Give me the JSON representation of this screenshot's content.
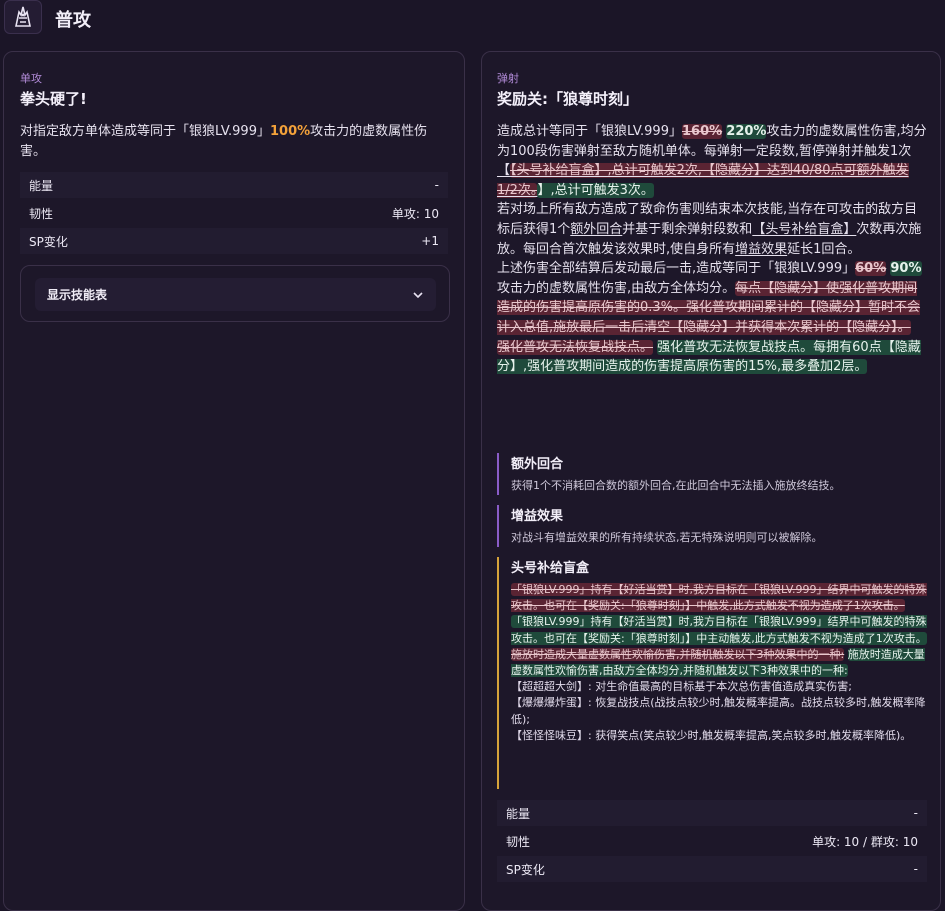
{
  "page": {
    "title": "普攻"
  },
  "left": {
    "kind": "单攻",
    "name": "拳头硬了!",
    "desc": {
      "pre": "对指定敌方单体造成等同于「银狼LV.999」",
      "pct": "100%",
      "post": "攻击力的虚数属性伤害。"
    },
    "stats": [
      {
        "label": "能量",
        "value": "-"
      },
      {
        "label": "韧性",
        "value": "单攻: 10"
      },
      {
        "label": "SP变化",
        "value": "+1"
      }
    ],
    "toggle_label": "显示技能表"
  },
  "right": {
    "kind": "弹射",
    "name": "奖励关:「狼尊时刻」",
    "desc": {
      "p1_a": "造成总计等同于「银狼LV.999」",
      "p1_del": "160%",
      "p1_ins": "220%",
      "p1_b": "攻击力的虚数属性伤害,均分为100段伤害弹射至敌方随机单体。每弹射一定段数,暂停弹射并触发1次",
      "p1_del2": "【头号补给盲盒】,总计可触发2次,【隐藏分】达到40/80点可额外触发1/2次。",
      "p1_ins2": "】,总计可触发3次。",
      "p2_a": "若对场上所有敌方造成了致命伤害则结束本次技能,当存在可攻击的敌方目标后获得1个",
      "p2_u1": "额外回合",
      "p2_b": "并基于剩余弹射段数和",
      "p2_u2": "【头号补给盲盒】",
      "p2_c": "次数再次施放。每回合首次触发该效果时,使自身所有",
      "p2_u3": "增益效果",
      "p2_d": "延长1回合。",
      "p3_a": "上述伤害全部结算后发动最后一击,造成等同于「银狼LV.999」",
      "p3_del": "60%",
      "p3_ins": "90%",
      "p3_b": "攻击力的虚数属性伤害,由敌方全体均分。",
      "p3_del2": "每点【隐藏分】使强化普攻期间造成的伤害提高原伤害的0.3%。强化普攻期间累计的【隐藏分】暂时不会计入总值,施放最后一击后清空【隐藏分】并获得本次累计的【隐藏分】。",
      "p4_del": "强化普攻无法恢复战技点。",
      "p4_ins": "强化普攻无法恢复战技点。每拥有60点【隐藏分】,强化普攻期间造成的伤害提高原伤害的15%,最多叠加2层。"
    },
    "notes": [
      {
        "title": "额外回合",
        "body": "获得1个不消耗回合数的额外回合,在此回合中无法插入施放终结技。"
      },
      {
        "title": "增益效果",
        "body": "对战斗有增益效果的所有持续状态,若无特殊说明则可以被解除。"
      }
    ],
    "box_note": {
      "title": "头号补给盲盒",
      "del1": "「银狼LV.999」持有【好活当赏】时,我方目标在「银狼LV.999」结界中可触发的特殊攻击。也可在【奖励关:「狼尊时刻」】中触发,此方式触发不视为造成了1次攻击。",
      "ins1": "「银狼LV.999」持有【好活当赏】时,我方目标在「银狼LV.999」结界中可触发的特殊攻击。也可在【奖励关:「狼尊时刻」】中主动触发,此方式触发不视为造成了1次攻击。",
      "del2": "施放时造成大量虚数属性欢愉伤害,并随机触发以下3种效果中的一种:",
      "ins2": "施放时造成大量虚数属性欢愉伤害,由敌方全体均分,并随机触发以下3种效果中的一种:",
      "line3": "【超超超大剑】: 对生命值最高的目标基于本次总伤害值造成真实伤害;",
      "line4": "【爆爆爆炸蛋】: 恢复战技点(战技点较少时,触发概率提高。战技点较多时,触发概率降低);",
      "line5": "【怪怪怪味豆】: 获得笑点(笑点较少时,触发概率提高,笑点较多时,触发概率降低)。"
    },
    "stats": [
      {
        "label": "能量",
        "value": "-"
      },
      {
        "label": "韧性",
        "value": "单攻: 10 / 群攻: 10"
      },
      {
        "label": "SP变化",
        "value": "-"
      }
    ]
  }
}
